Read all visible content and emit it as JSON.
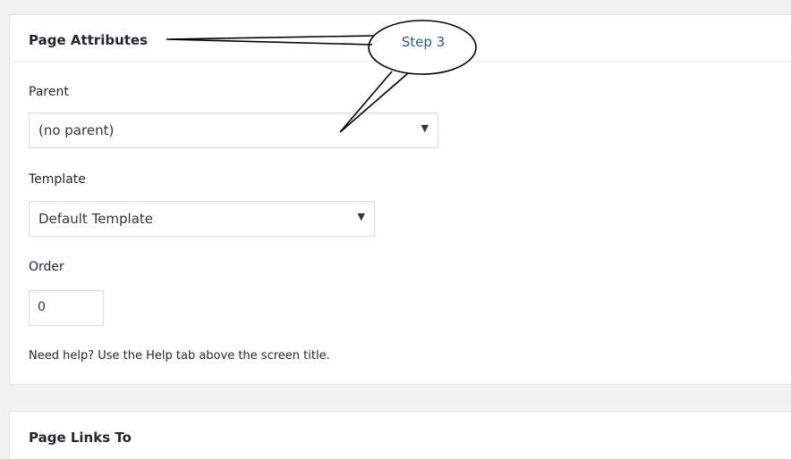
{
  "page_attributes": {
    "title": "Page Attributes",
    "parent": {
      "label": "Parent",
      "selected": "(no parent)"
    },
    "template": {
      "label": "Template",
      "selected": "Default Template"
    },
    "order": {
      "label": "Order",
      "value": "0"
    },
    "help_text": "Need help? Use the Help tab above the screen title."
  },
  "page_links": {
    "title": "Page Links To"
  },
  "annotation": {
    "label": "Step 3"
  },
  "colors": {
    "panel_bg": "#ffffff",
    "page_bg": "#f1f1f1",
    "annotation_text": "#1f5fa8"
  },
  "icons": {
    "dropdown": "triangle-down-icon"
  }
}
